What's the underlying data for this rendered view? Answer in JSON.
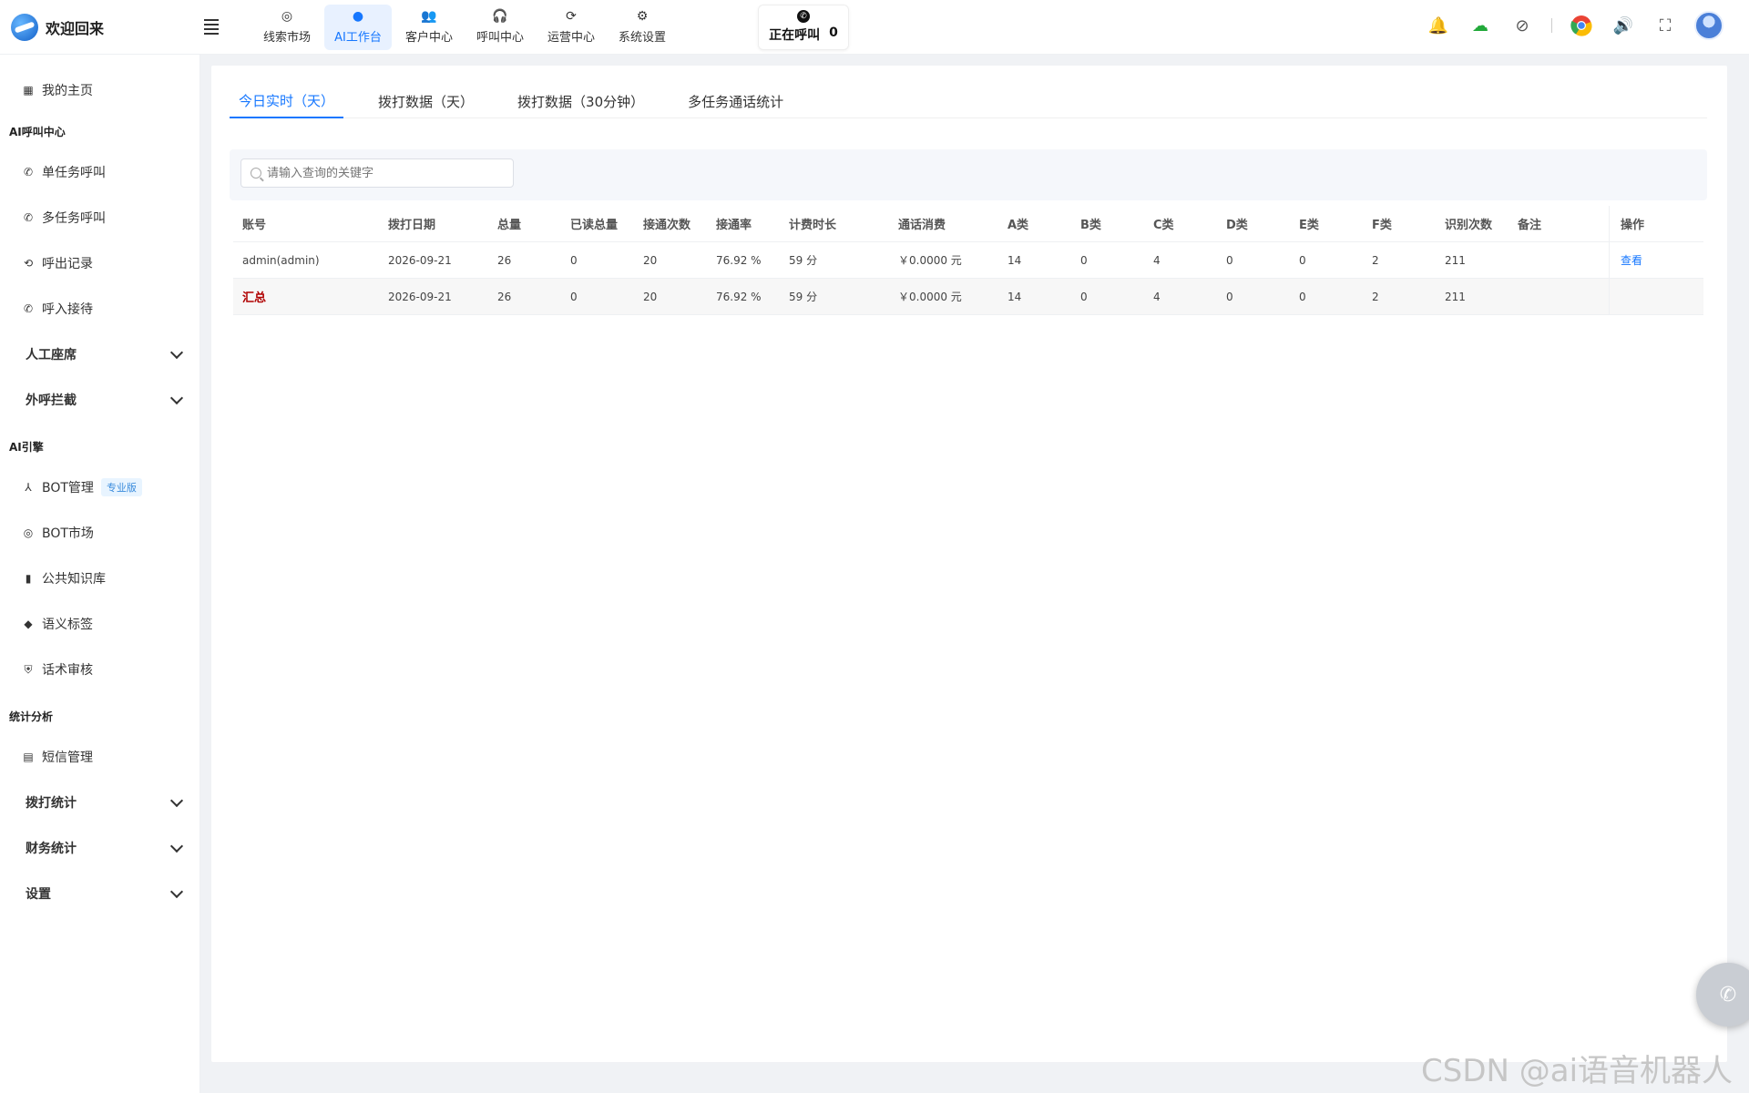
{
  "brand": {
    "title": "欢迎回来"
  },
  "topnav": [
    {
      "label": "线索市场",
      "icon": "check-circle-icon",
      "active": false
    },
    {
      "label": "AI工作台",
      "icon": "ai-dot-icon",
      "active": true
    },
    {
      "label": "客户中心",
      "icon": "users-icon",
      "active": false
    },
    {
      "label": "呼叫中心",
      "icon": "headset-icon",
      "active": false
    },
    {
      "label": "运营中心",
      "icon": "cycle-icon",
      "active": false
    },
    {
      "label": "系统设置",
      "icon": "gear-icon",
      "active": false
    }
  ],
  "calling": {
    "label": "正在呼叫",
    "count": "0"
  },
  "sidebar": {
    "home": "我的主页",
    "groups": [
      {
        "title": "AI呼叫中心",
        "items": [
          {
            "label": "单任务呼叫",
            "icon": "phone-icon"
          },
          {
            "label": "多任务呼叫",
            "icon": "phone-multi-icon"
          },
          {
            "label": "呼出记录",
            "icon": "history-icon"
          },
          {
            "label": "呼入接待",
            "icon": "phone-in-icon"
          }
        ],
        "collapsibles": [
          "人工座席",
          "外呼拦截"
        ]
      },
      {
        "title": "AI引擎",
        "items": [
          {
            "label": "BOT管理",
            "icon": "bot-icon",
            "badge": "专业版"
          },
          {
            "label": "BOT市场",
            "icon": "market-icon"
          },
          {
            "label": "公共知识库",
            "icon": "book-icon"
          },
          {
            "label": "语义标签",
            "icon": "tag-icon"
          },
          {
            "label": "话术审核",
            "icon": "shield-icon"
          }
        ]
      },
      {
        "title": "统计分析",
        "items": [
          {
            "label": "短信管理",
            "icon": "sms-icon"
          }
        ],
        "collapsibles": [
          "拨打统计",
          "财务统计",
          "设置"
        ]
      }
    ]
  },
  "tabs": [
    {
      "label": "今日实时（天）",
      "active": true
    },
    {
      "label": "拨打数据（天）",
      "active": false
    },
    {
      "label": "拨打数据（30分钟）",
      "active": false
    },
    {
      "label": "多任务通话统计",
      "active": false
    }
  ],
  "search": {
    "placeholder": "请输入查询的关键字"
  },
  "table": {
    "columns": [
      "账号",
      "拨打日期",
      "总量",
      "已读总量",
      "接通次数",
      "接通率",
      "计费时长",
      "通话消费",
      "A类",
      "B类",
      "C类",
      "D类",
      "E类",
      "F类",
      "识别次数",
      "备注",
      "操作"
    ],
    "rows": [
      [
        "admin(admin)",
        "2026-09-21",
        "26",
        "0",
        "20",
        "76.92 %",
        "59 分",
        "￥0.0000 元",
        "14",
        "0",
        "4",
        "0",
        "0",
        "2",
        "211",
        "",
        "查看"
      ]
    ],
    "summary": [
      "汇总",
      "2026-09-21",
      "26",
      "0",
      "20",
      "76.92 %",
      "59 分",
      "￥0.0000 元",
      "14",
      "0",
      "4",
      "0",
      "0",
      "2",
      "211",
      "",
      ""
    ]
  },
  "watermark": "CSDN @ai语音机器人"
}
